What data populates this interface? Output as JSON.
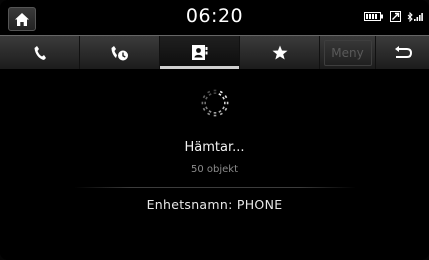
{
  "status": {
    "time": "06:20"
  },
  "tabs": [
    {
      "icon": "phone-icon"
    },
    {
      "icon": "recent-calls-icon"
    },
    {
      "icon": "contacts-icon",
      "active": true
    },
    {
      "icon": "star-icon"
    }
  ],
  "menu_label": "Meny",
  "main": {
    "loading_text": "Hämtar...",
    "count_text": "50 objekt",
    "device_label": "Enhetsnamn:",
    "device_name": "PHONE"
  },
  "colors": {
    "background": "#000000",
    "tab_bar": "#2e2e2e",
    "active_indicator": "#cfcfcf",
    "text_primary": "#ffffff",
    "text_secondary": "#8c8c8c",
    "menu_disabled": "#5a5a5a"
  }
}
